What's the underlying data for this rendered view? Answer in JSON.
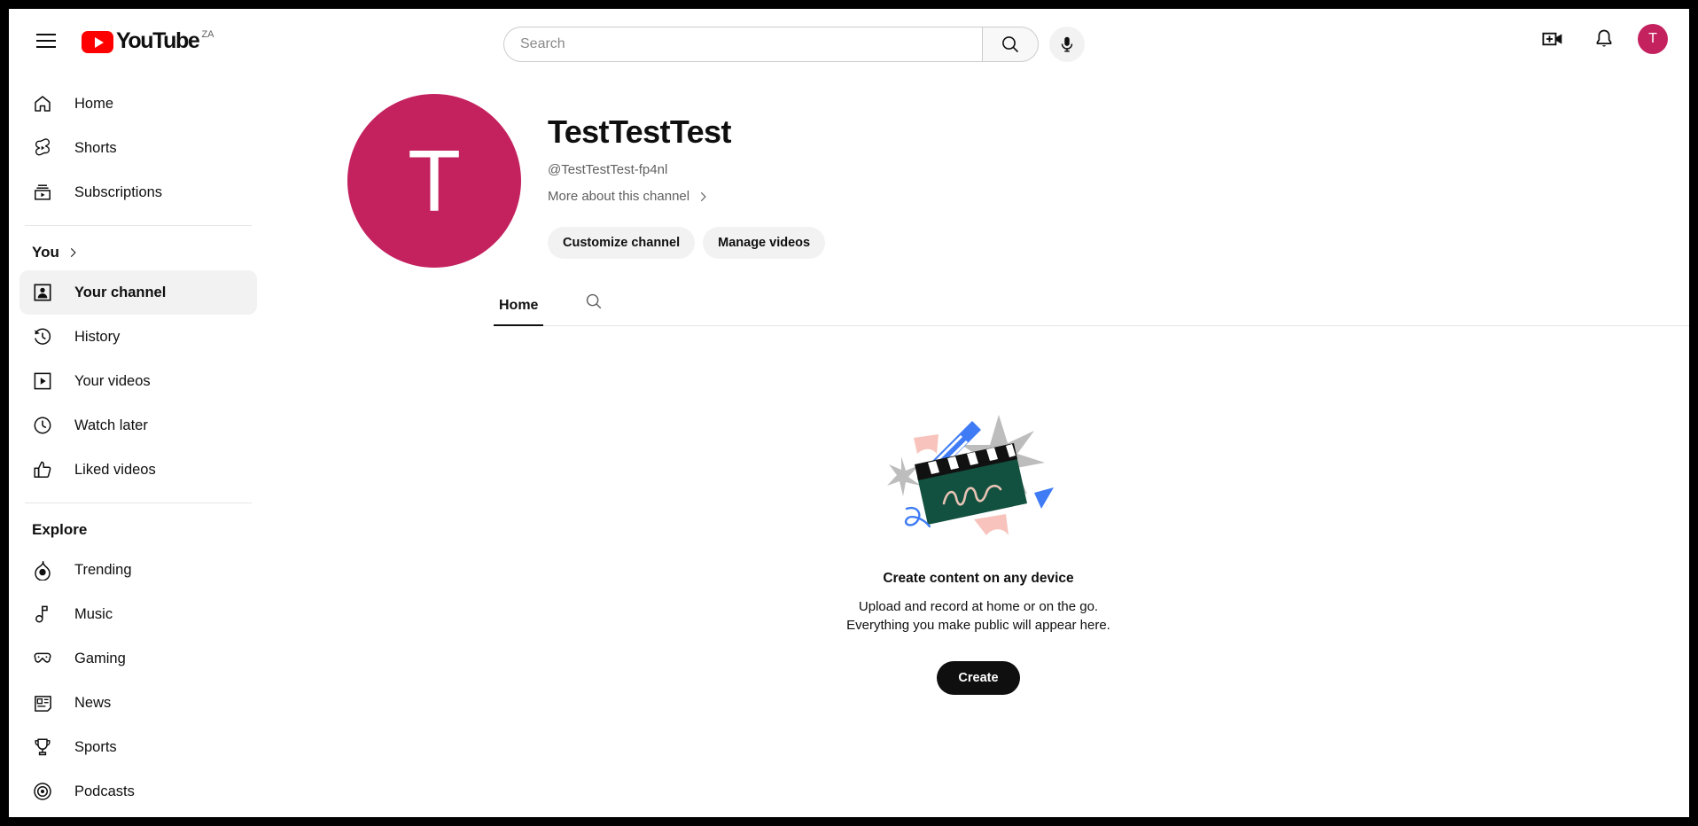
{
  "header": {
    "menu_icon": "hamburger-icon",
    "logo_text": "YouTube",
    "country_code": "ZA",
    "search": {
      "value": "",
      "placeholder": "Search"
    },
    "search_button_icon": "search-icon",
    "mic_icon": "microphone-icon",
    "create_video_icon": "create-video-icon",
    "notifications_icon": "bell-icon",
    "avatar_letter": "T",
    "avatar_color": "#C4225F"
  },
  "sidebar": {
    "primary": [
      {
        "label": "Home",
        "icon": "home-icon",
        "active": false
      },
      {
        "label": "Shorts",
        "icon": "shorts-icon",
        "active": false
      },
      {
        "label": "Subscriptions",
        "icon": "subscriptions-icon",
        "active": false
      }
    ],
    "you_section": {
      "label": "You",
      "chevron": "chevron-right-icon"
    },
    "you_items": [
      {
        "label": "Your channel",
        "icon": "person-icon",
        "active": true
      },
      {
        "label": "History",
        "icon": "history-icon",
        "active": false
      },
      {
        "label": "Your videos",
        "icon": "video-icon",
        "active": false
      },
      {
        "label": "Watch later",
        "icon": "clock-icon",
        "active": false
      },
      {
        "label": "Liked videos",
        "icon": "thumbs-up-icon",
        "active": false
      }
    ],
    "explore_section": {
      "label": "Explore"
    },
    "explore_items": [
      {
        "label": "Trending",
        "icon": "trending-icon"
      },
      {
        "label": "Music",
        "icon": "music-note-icon"
      },
      {
        "label": "Gaming",
        "icon": "gamepad-icon"
      },
      {
        "label": "News",
        "icon": "newspaper-icon"
      },
      {
        "label": "Sports",
        "icon": "trophy-icon"
      },
      {
        "label": "Podcasts",
        "icon": "podcast-icon"
      }
    ]
  },
  "channel": {
    "avatar_letter": "T",
    "avatar_color": "#C4225F",
    "name": "TestTestTest",
    "handle": "@TestTestTest-fp4nl",
    "more_link": "More about this channel",
    "buttons": {
      "customize": "Customize channel",
      "manage": "Manage videos"
    },
    "tabs": [
      {
        "label": "Home",
        "active": true
      }
    ],
    "tab_search_icon": "search-icon"
  },
  "empty_state": {
    "illustration": "clapperboard-illustration",
    "title": "Create content on any device",
    "line1": "Upload and record at home or on the go.",
    "line2": "Everything you make public will appear here.",
    "button": "Create"
  },
  "colors": {
    "youtube_red": "#FF0000",
    "accent_pink": "#C4225F",
    "text_primary": "#0F0F0F",
    "text_secondary": "#606060"
  }
}
